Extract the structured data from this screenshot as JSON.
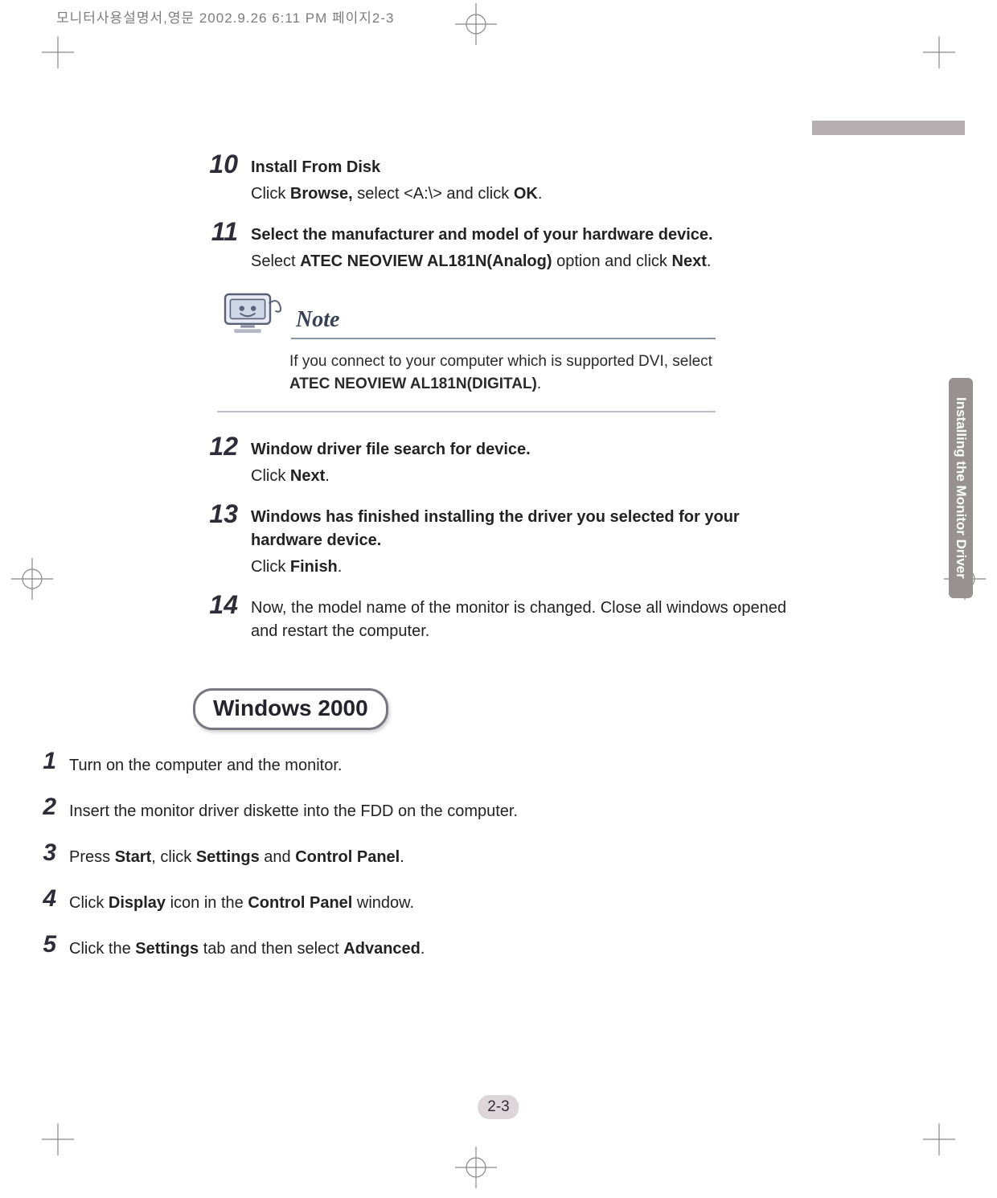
{
  "print_header": "모니터사용설명서,영문  2002.9.26 6:11 PM  페이지2-3",
  "side_tab": "Installing the Monitor Driver",
  "steps_a": [
    {
      "num": "10",
      "title": "Install From Disk",
      "parts": [
        "Click ",
        {
          "b": "Browse,"
        },
        " select <A:\\> and click ",
        {
          "b": "OK"
        },
        "."
      ]
    },
    {
      "num": "11",
      "title": "Select the manufacturer and model of your hardware device.",
      "parts": [
        "Select ",
        {
          "b": "ATEC NEOVIEW AL181N(Analog)"
        },
        " option and click ",
        {
          "b": "Next"
        },
        "."
      ]
    }
  ],
  "note": {
    "heading": "Note",
    "parts": [
      "If you connect to your computer which is supported DVI, select ",
      {
        "b": "ATEC NEOVIEW AL181N(DIGITAL)"
      },
      "."
    ]
  },
  "steps_b": [
    {
      "num": "12",
      "title": "Window driver file search for device.",
      "parts": [
        "Click ",
        {
          "b": "Next"
        },
        "."
      ]
    },
    {
      "num": "13",
      "title": "Windows has finished installing the driver you selected for your hardware device.",
      "parts": [
        "Click ",
        {
          "b": "Finish"
        },
        "."
      ]
    },
    {
      "num": "14",
      "title": "",
      "parts": [
        "Now, the model name of the monitor is changed. Close all windows opened and restart the computer."
      ]
    }
  ],
  "section2": "Windows 2000",
  "steps_c": [
    {
      "num": "1",
      "parts": [
        "Turn on the computer and the monitor."
      ]
    },
    {
      "num": "2",
      "parts": [
        "Insert the monitor driver diskette into the FDD on the computer."
      ]
    },
    {
      "num": "3",
      "parts": [
        "Press ",
        {
          "b": "Start"
        },
        ", click ",
        {
          "b": "Settings"
        },
        " and ",
        {
          "b": "Control Panel"
        },
        "."
      ]
    },
    {
      "num": "4",
      "parts": [
        "Click ",
        {
          "b": "Display"
        },
        " icon in the ",
        {
          "b": "Control Panel"
        },
        " window."
      ]
    },
    {
      "num": "5",
      "parts": [
        "Click the ",
        {
          "b": "Settings"
        },
        " tab and then select ",
        {
          "b": "Advanced"
        },
        "."
      ]
    }
  ],
  "page_number": "2-3"
}
